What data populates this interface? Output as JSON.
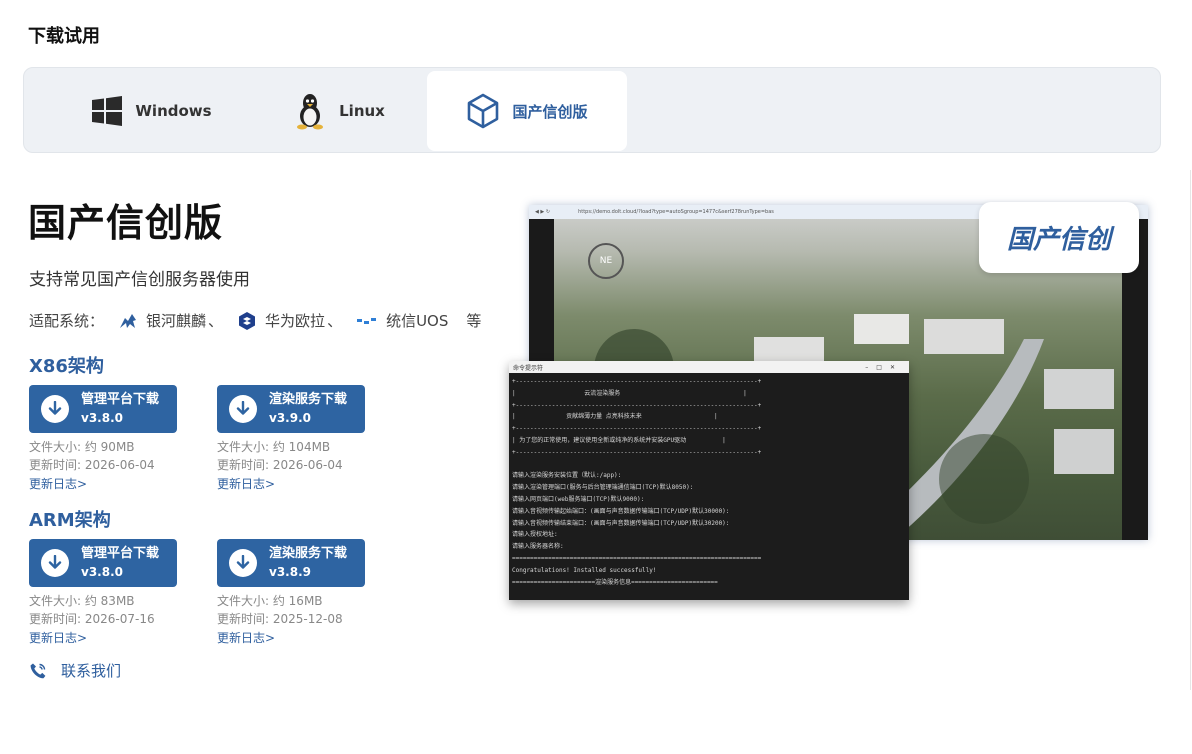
{
  "section_title": "下载试用",
  "tabs": [
    {
      "label": "Windows",
      "icon": "windows-icon"
    },
    {
      "label": "Linux",
      "icon": "linux-tux-icon"
    },
    {
      "label": "国产信创版",
      "icon": "cube-icon",
      "active": true
    }
  ],
  "edition": {
    "title": "国产信创版",
    "subtitle": "支持常见国产信创服务器使用",
    "compat_label": "适配系统：",
    "compat_items": [
      {
        "name": "银河麒麟",
        "icon": "kylin-icon",
        "sep": "、"
      },
      {
        "name": "华为欧拉",
        "icon": "openeuler-icon",
        "sep": "、"
      },
      {
        "name": "统信UOS",
        "icon": "uos-icon",
        "sep": ""
      }
    ],
    "compat_suffix": "等"
  },
  "x86": {
    "title": "X86架构",
    "downloads": [
      {
        "label": "管理平台下载",
        "version": "v3.8.0",
        "size": "文件大小: 约 90MB",
        "updated": "更新时间: 2026-06-04",
        "log": "更新日志>"
      },
      {
        "label": "渲染服务下载",
        "version": "v3.9.0",
        "size": "文件大小: 约 104MB",
        "updated": "更新时间: 2026-06-04",
        "log": "更新日志>"
      }
    ]
  },
  "arm": {
    "title": "ARM架构",
    "downloads": [
      {
        "label": "管理平台下载",
        "version": "v3.8.0",
        "size": "文件大小: 约 83MB",
        "updated": "更新时间: 2026-07-16",
        "log": "更新日志>"
      },
      {
        "label": "渲染服务下载",
        "version": "v3.8.9",
        "size": "文件大小: 约 16MB",
        "updated": "更新时间: 2025-12-08",
        "log": "更新日志>"
      }
    ]
  },
  "contact": "联系我们",
  "preview": {
    "browser_url": "https://demo.dolt.cloud/?load?type=autoSgroup=1477c&serf278runType=bas",
    "badge": "国产信创",
    "compass": "NE",
    "console_title": "命令提示符",
    "console_lines": [
      "+-------------------------------------------------------------------+",
      "|                   云流渲染服务                                  |",
      "+-------------------------------------------------------------------+",
      "|              贡献绵薄力量 点亮科技未来                    |",
      "+-------------------------------------------------------------------+",
      "| 为了您的正常使用，建议使用全新或纯净的系统并安装GPU驱动          |",
      "+-------------------------------------------------------------------+",
      "",
      "请输入渲染服务安装位置（默认:/app):",
      "请输入渲染管理端口(服务与后台管理端通信端口(TCP)默认8050):",
      "请输入网页端口(web服务端口(TCP)默认9000):",
      "请输入音视频传输起始端口：(画面与声音数据传输端口(TCP/UDP)默认30000):",
      "请输入音视频传输结束端口：(画面与声音数据传输端口(TCP/UDP)默认30200):",
      "请输入授权地址:",
      "请输入服务器名称:",
      "=====================================================================",
      "Congratulations! Installed successfully!",
      "=======================渲染服务信息========================"
    ]
  }
}
